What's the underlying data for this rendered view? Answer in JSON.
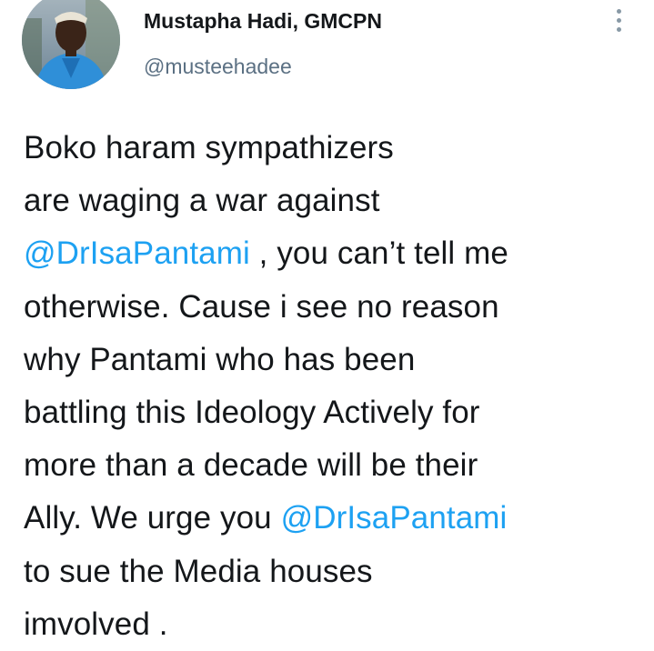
{
  "tweet": {
    "author": {
      "display_name": "Mustapha Hadi, GMCPN",
      "handle": "@musteehadee"
    },
    "more_icon": "more-vertical-icon",
    "text_lines": [
      {
        "segments": [
          {
            "text": "Boko haram sympathizers",
            "type": "text"
          }
        ]
      },
      {
        "segments": [
          {
            "text": "are waging a war against",
            "type": "text"
          }
        ]
      },
      {
        "segments": [
          {
            "text": "@DrIsaPantami",
            "type": "mention"
          },
          {
            "text": " ,  you can’t tell me",
            "type": "text"
          }
        ]
      },
      {
        "segments": [
          {
            "text": "otherwise. Cause i see no reason",
            "type": "text"
          }
        ]
      },
      {
        "segments": [
          {
            "text": "why Pantami who has been",
            "type": "text"
          }
        ]
      },
      {
        "segments": [
          {
            "text": "battling this Ideology Actively for",
            "type": "text"
          }
        ]
      },
      {
        "segments": [
          {
            "text": "more than a decade will be their",
            "type": "text"
          }
        ]
      },
      {
        "segments": [
          {
            "text": "Ally. We urge you ",
            "type": "text"
          },
          {
            "text": "@DrIsaPantami",
            "type": "mention"
          }
        ]
      },
      {
        "segments": [
          {
            "text": "to sue the Media houses",
            "type": "text"
          }
        ]
      },
      {
        "segments": [
          {
            "text": "imvolved .",
            "type": "text"
          }
        ]
      }
    ]
  },
  "colors": {
    "text": "#14171a",
    "secondary_text": "#5b7083",
    "mention": "#1da1f2",
    "icon": "#8899a6"
  }
}
